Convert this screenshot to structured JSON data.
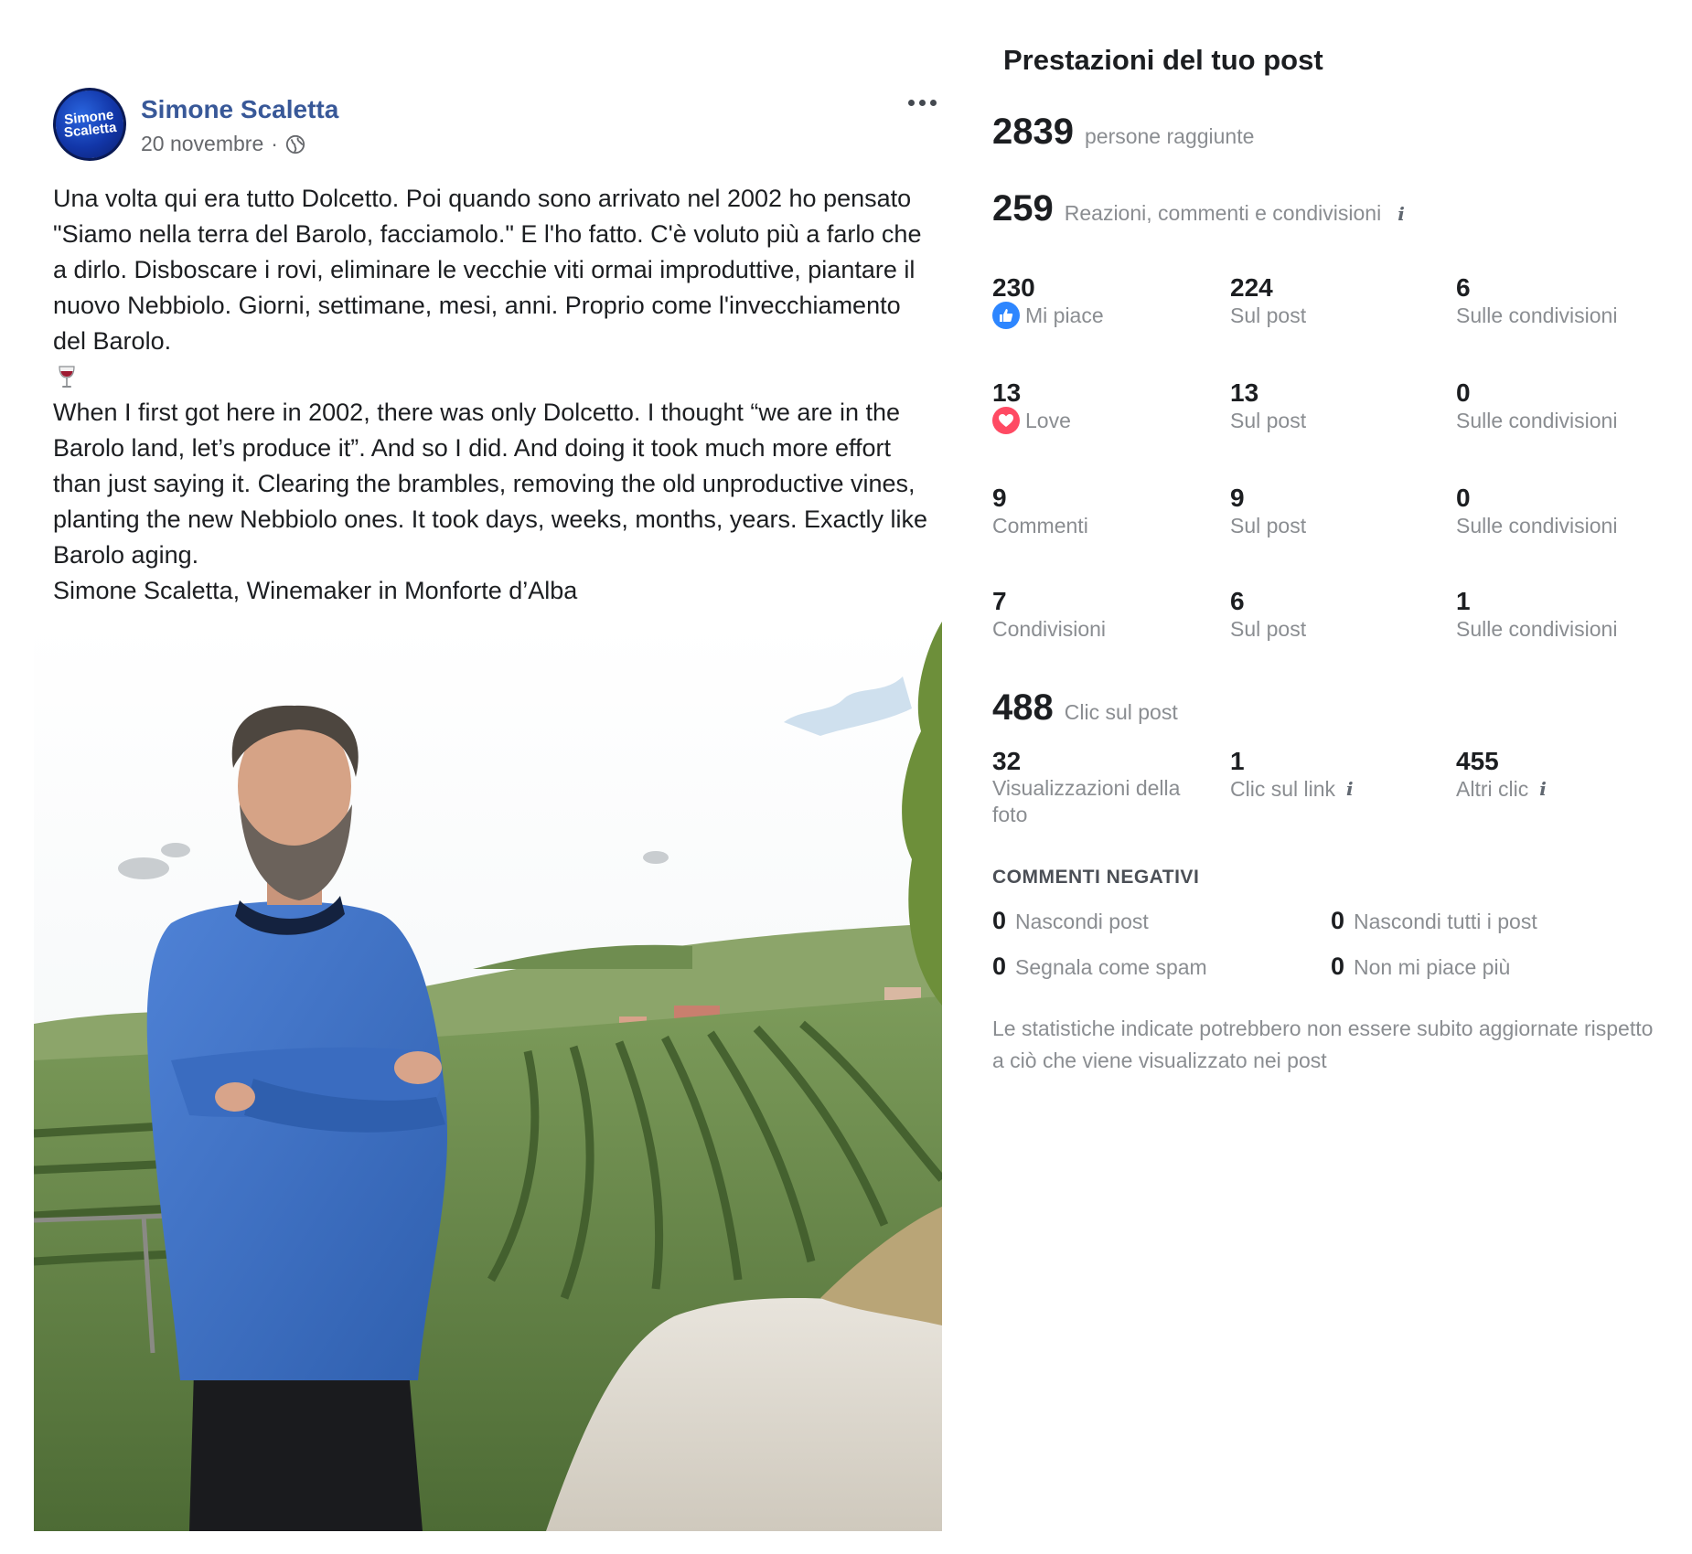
{
  "post": {
    "author": "Simone Scaletta",
    "avatar_text_line1": "Simone",
    "avatar_text_line2": "Scaletta",
    "date": "20 novembre",
    "separator": "·",
    "privacy_icon": "globe-icon",
    "more_icon": "more-options-icon",
    "text_it": "Una volta qui era tutto Dolcetto. Poi quando sono arrivato nel 2002 ho pensato \"Siamo nella terra del Barolo, facciamolo.\" E l'ho fatto. C'è voluto più a farlo che a dirlo. Disboscare i rovi, eliminare le vecchie viti ormai improduttive, piantare il nuovo Nebbiolo. Giorni, settimane, mesi, anni. Proprio come l'invecchiamento del Barolo.",
    "emoji_icon": "wine-glass-icon",
    "text_en": "When I first got here in 2002, there was only Dolcetto. I thought “we are in the Barolo land, let’s produce it”. And so I did. And doing it took much more effort than just saying it. Clearing the brambles, removing the old unproductive vines, planting the new Nebbiolo ones. It took days, weeks, months, years. Exactly like Barolo aging.",
    "signature": "Simone Scaletta, Winemaker in Monforte d’Alba"
  },
  "insights": {
    "title": "Prestazioni del tuo post",
    "reach": {
      "value": "2839",
      "label": "persone raggiunte"
    },
    "engagement": {
      "value": "259",
      "label": "Reazioni, commenti e condivisioni"
    },
    "rows": [
      {
        "total": "230",
        "label": "Mi piace",
        "icon": "like-icon",
        "on_post": "224",
        "on_post_label": "Sul post",
        "on_shares": "6",
        "on_shares_label": "Sulle condivisioni"
      },
      {
        "total": "13",
        "label": "Love",
        "icon": "love-icon",
        "on_post": "13",
        "on_post_label": "Sul post",
        "on_shares": "0",
        "on_shares_label": "Sulle condivisioni"
      },
      {
        "total": "9",
        "label": "Commenti",
        "on_post": "9",
        "on_post_label": "Sul post",
        "on_shares": "0",
        "on_shares_label": "Sulle condivisioni"
      },
      {
        "total": "7",
        "label": "Condivisioni",
        "on_post": "6",
        "on_post_label": "Sul post",
        "on_shares": "1",
        "on_shares_label": "Sulle condivisioni"
      }
    ],
    "clicks": {
      "value": "488",
      "label": "Clic sul post"
    },
    "click_breakdown": [
      {
        "value": "32",
        "label": "Visualizzazioni della foto"
      },
      {
        "value": "1",
        "label": "Clic sul link"
      },
      {
        "value": "455",
        "label": "Altri clic"
      }
    ],
    "negative": {
      "title": "COMMENTI NEGATIVI",
      "items": [
        {
          "value": "0",
          "label": "Nascondi post"
        },
        {
          "value": "0",
          "label": "Nascondi tutti i post"
        },
        {
          "value": "0",
          "label": "Segnala come spam"
        },
        {
          "value": "0",
          "label": "Non mi piace più"
        }
      ]
    },
    "disclaimer": "Le statistiche indicate potrebbero non essere subito aggiornate rispetto a ciò che viene visualizzato nei post",
    "info_icon": "info-icon"
  },
  "colors": {
    "author_link": "#385898",
    "muted_text": "#8a8d91",
    "like_blue": "#2d86ff",
    "love_red": "#ff4a63",
    "sweater_blue": "#3f72c8"
  }
}
